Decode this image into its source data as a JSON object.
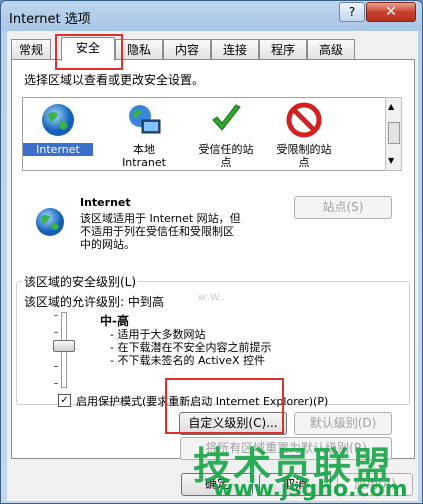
{
  "window": {
    "title": "Internet 选项",
    "help": "?",
    "close": "✕"
  },
  "tabs": [
    {
      "label": "常规"
    },
    {
      "label": "安全"
    },
    {
      "label": "隐私"
    },
    {
      "label": "内容"
    },
    {
      "label": "连接"
    },
    {
      "label": "程序"
    },
    {
      "label": "高级"
    }
  ],
  "security": {
    "instruction": "选择区域以查看或更改安全设置。",
    "zones": [
      {
        "label": "Internet",
        "icon": "globe-icon",
        "selected": true
      },
      {
        "label": "本地\nIntranet",
        "icon": "intranet-icon"
      },
      {
        "label": "受信任的站\n点",
        "icon": "checkmark-icon"
      },
      {
        "label": "受限制的站\n点",
        "icon": "restricted-icon"
      }
    ],
    "selected_zone_title": "Internet",
    "sites_button": "站点(S)",
    "description_lines": [
      "该区域适用于 Internet 网站，但",
      "不适用于列在受信任和受限制区",
      "中的网站。"
    ],
    "level_group_label": "该区域的安全级别(L)",
    "allowed_levels": "该区域的允许级别: 中到高",
    "level_name": "中-高",
    "level_bullets": [
      "- 适用于大多数网站",
      "- 在下载潜在不安全内容之前提示",
      "- 不下载未签名的 ActiveX 控件"
    ],
    "level_value": 0.5,
    "protected_mode_checked": true,
    "protected_mode_label": "启用保护模式(要求重新启动 Internet Explorer)(P)",
    "custom_level_button": "自定义级别(C)...",
    "default_level_button": "默认级别(D)",
    "reset_all_button": "将所有区域重置为默认级别(R)"
  },
  "footer": {
    "ok": "确定",
    "cancel": "取消",
    "apply": "应用(A)"
  },
  "watermark": {
    "text": "技术员联盟",
    "url": "www.jsgho.com",
    "faint": "w..W.."
  },
  "colors": {
    "highlight_red": "#e0302a",
    "selection_blue": "#3a6fcc",
    "watermark_green": "#1aa84a"
  }
}
